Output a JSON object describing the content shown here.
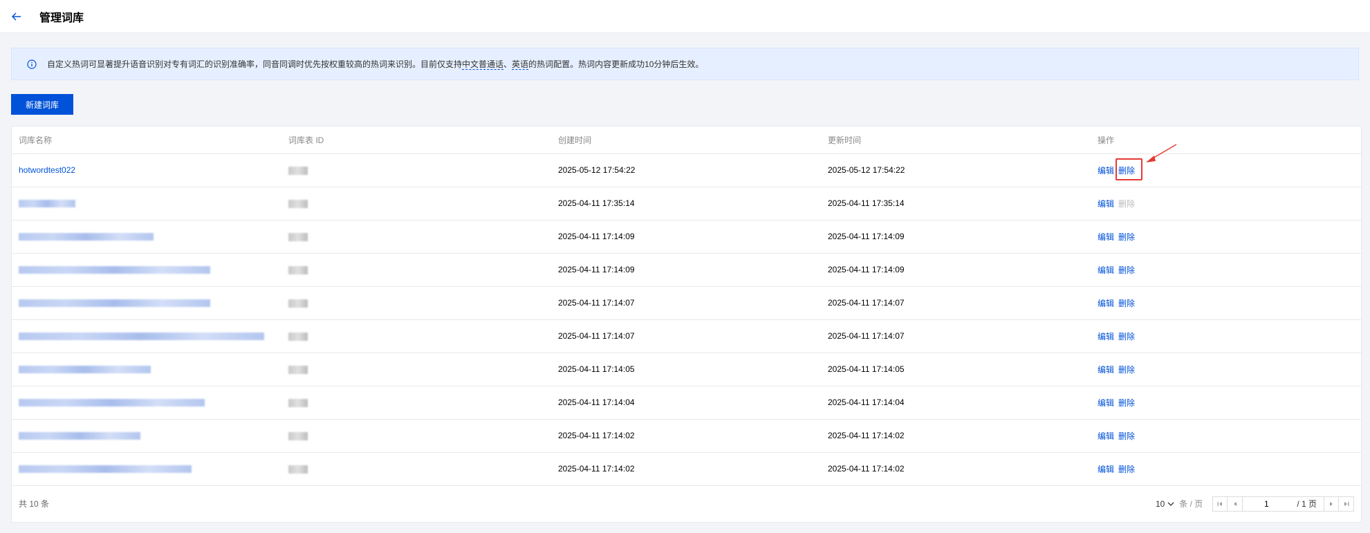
{
  "header": {
    "title": "管理词库"
  },
  "notice": {
    "text_before": "自定义热词可显著提升语音识别对专有词汇的识别准确率，同音同调时优先按权重较高的热词来识别。目前仅支持",
    "link1": "中文普通话",
    "sep": "、",
    "link2": "英语",
    "text_after": "的热词配置。热词内容更新成功10分钟后生效。"
  },
  "toolbar": {
    "new_label": "新建词库"
  },
  "table": {
    "columns": [
      "词库名称",
      "词库表 ID",
      "创建时间",
      "更新时间",
      "操作"
    ],
    "rows": [
      {
        "name": "hotwordtest022",
        "created": "2025-05-12 17:54:22",
        "updated": "2025-05-12 17:54:22",
        "edit": "编辑",
        "delete": "删除",
        "delete_disabled": false,
        "name_blur": false,
        "highlight": true
      },
      {
        "name": "",
        "created": "2025-04-11 17:35:14",
        "updated": "2025-04-11 17:35:14",
        "edit": "编辑",
        "delete": "删除",
        "delete_disabled": true,
        "name_blur": true,
        "blur_width": 0.21
      },
      {
        "name": "",
        "created": "2025-04-11 17:14:09",
        "updated": "2025-04-11 17:14:09",
        "edit": "编辑",
        "delete": "删除",
        "delete_disabled": false,
        "name_blur": true,
        "blur_width": 0.5
      },
      {
        "name": "",
        "created": "2025-04-11 17:14:09",
        "updated": "2025-04-11 17:14:09",
        "edit": "编辑",
        "delete": "删除",
        "delete_disabled": false,
        "name_blur": true,
        "blur_width": 0.71
      },
      {
        "name": "",
        "created": "2025-04-11 17:14:07",
        "updated": "2025-04-11 17:14:07",
        "edit": "编辑",
        "delete": "删除",
        "delete_disabled": false,
        "name_blur": true,
        "blur_width": 0.71
      },
      {
        "name": "",
        "created": "2025-04-11 17:14:07",
        "updated": "2025-04-11 17:14:07",
        "edit": "编辑",
        "delete": "删除",
        "delete_disabled": false,
        "name_blur": true,
        "blur_width": 0.91
      },
      {
        "name": "",
        "created": "2025-04-11 17:14:05",
        "updated": "2025-04-11 17:14:05",
        "edit": "编辑",
        "delete": "删除",
        "delete_disabled": false,
        "name_blur": true,
        "blur_width": 0.49
      },
      {
        "name": "",
        "created": "2025-04-11 17:14:04",
        "updated": "2025-04-11 17:14:04",
        "edit": "编辑",
        "delete": "删除",
        "delete_disabled": false,
        "name_blur": true,
        "blur_width": 0.69
      },
      {
        "name": "",
        "created": "2025-04-11 17:14:02",
        "updated": "2025-04-11 17:14:02",
        "edit": "编辑",
        "delete": "删除",
        "delete_disabled": false,
        "name_blur": true,
        "blur_width": 0.45
      },
      {
        "name": "",
        "created": "2025-04-11 17:14:02",
        "updated": "2025-04-11 17:14:02",
        "edit": "编辑",
        "delete": "删除",
        "delete_disabled": false,
        "name_blur": true,
        "blur_width": 0.64
      }
    ]
  },
  "footer": {
    "total": "共 10 条",
    "page_size": "10",
    "per_page": "条 / 页",
    "current_page": "1",
    "total_pages": "/ 1 页"
  },
  "colors": {
    "primary": "#0052d9",
    "highlight": "#e53935"
  }
}
